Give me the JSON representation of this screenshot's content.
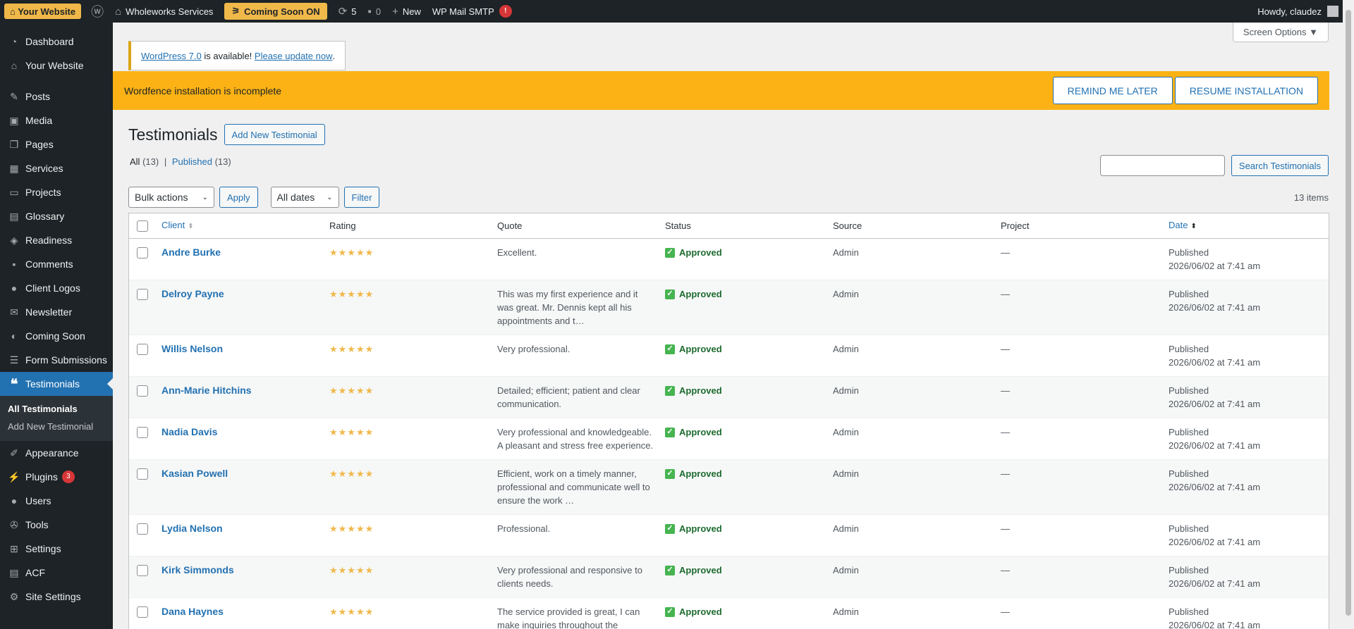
{
  "adminbar": {
    "site_label": "⌂ Your Website",
    "site_name": "Wholeworks Services",
    "coming_soon": "Coming Soon ON",
    "updates_count": "5",
    "comments_count": "0",
    "new_label": "New",
    "smtp_label": "WP Mail SMTP",
    "smtp_badge": "!",
    "howdy": "Howdy, claudez"
  },
  "sidebar": {
    "items": [
      {
        "label": "Dashboard",
        "icon": "dashboard-icon"
      },
      {
        "label": "Your Website",
        "icon": "home-icon"
      },
      {
        "label": "Posts",
        "icon": "pin-icon"
      },
      {
        "label": "Media",
        "icon": "media-icon"
      },
      {
        "label": "Pages",
        "icon": "pages-icon"
      },
      {
        "label": "Services",
        "icon": "grid-icon"
      },
      {
        "label": "Projects",
        "icon": "folder-icon"
      },
      {
        "label": "Glossary",
        "icon": "book-icon"
      },
      {
        "label": "Readiness",
        "icon": "tag-icon"
      },
      {
        "label": "Comments",
        "icon": "comment-icon"
      },
      {
        "label": "Client Logos",
        "icon": "person-icon"
      },
      {
        "label": "Newsletter",
        "icon": "mail-icon"
      },
      {
        "label": "Coming Soon",
        "icon": "megaphone-icon"
      },
      {
        "label": "Form Submissions",
        "icon": "form-icon"
      },
      {
        "label": "Testimonials",
        "icon": "quote-icon"
      },
      {
        "label": "Appearance",
        "icon": "brush-icon"
      },
      {
        "label": "Plugins",
        "icon": "plugin-icon",
        "badge": "3"
      },
      {
        "label": "Users",
        "icon": "users-icon"
      },
      {
        "label": "Tools",
        "icon": "wrench-icon"
      },
      {
        "label": "Settings",
        "icon": "settings-icon"
      },
      {
        "label": "ACF",
        "icon": "acf-icon"
      },
      {
        "label": "Site Settings",
        "icon": "gear-icon"
      }
    ],
    "submenu": {
      "all": "All Testimonials",
      "add_new": "Add New Testimonial"
    }
  },
  "screen_options": "Screen Options ▼",
  "update_nag": {
    "link": "WordPress 7.0",
    "middle": " is available! ",
    "update_link": "Please update now",
    "end": "."
  },
  "wordfence": {
    "message": "Wordfence installation is incomplete",
    "remind": "REMIND ME LATER",
    "resume": "RESUME INSTALLATION"
  },
  "page": {
    "title": "Testimonials",
    "add_new": "Add New Testimonial"
  },
  "views": {
    "all": "All",
    "all_count": "(13)",
    "sep": "|",
    "published": "Published",
    "published_count": "(13)"
  },
  "search": {
    "button": "Search Testimonials"
  },
  "tablenav": {
    "bulk": "Bulk actions",
    "apply": "Apply",
    "dates": "All dates",
    "filter": "Filter",
    "items": "13 items"
  },
  "table": {
    "headers": {
      "client": "Client",
      "rating": "Rating",
      "quote": "Quote",
      "status": "Status",
      "source": "Source",
      "project": "Project",
      "date": "Date"
    },
    "rows": [
      {
        "client": "Andre Burke",
        "rating": "★★★★★",
        "quote": "Excellent.",
        "status": "Approved",
        "source": "Admin",
        "project": "—",
        "date1": "Published",
        "date2": "2026/06/02 at 7:41 am"
      },
      {
        "client": "Delroy Payne",
        "rating": "★★★★★",
        "quote": "This was my first experience and it was great. Mr. Dennis kept all his appointments and t…",
        "status": "Approved",
        "source": "Admin",
        "project": "—",
        "date1": "Published",
        "date2": "2026/06/02 at 7:41 am"
      },
      {
        "client": "Willis Nelson",
        "rating": "★★★★★",
        "quote": "Very professional.",
        "status": "Approved",
        "source": "Admin",
        "project": "—",
        "date1": "Published",
        "date2": "2026/06/02 at 7:41 am"
      },
      {
        "client": "Ann-Marie Hitchins",
        "rating": "★★★★★",
        "quote": "Detailed; efficient; patient and clear communication.",
        "status": "Approved",
        "source": "Admin",
        "project": "—",
        "date1": "Published",
        "date2": "2026/06/02 at 7:41 am"
      },
      {
        "client": "Nadia Davis",
        "rating": "★★★★★",
        "quote": "Very professional and knowledgeable. A pleasant and stress free experience.",
        "status": "Approved",
        "source": "Admin",
        "project": "—",
        "date1": "Published",
        "date2": "2026/06/02 at 7:41 am"
      },
      {
        "client": "Kasian Powell",
        "rating": "★★★★★",
        "quote": "Efficient, work on a timely manner, professional and communicate well to ensure the work …",
        "status": "Approved",
        "source": "Admin",
        "project": "—",
        "date1": "Published",
        "date2": "2026/06/02 at 7:41 am"
      },
      {
        "client": "Lydia Nelson",
        "rating": "★★★★★",
        "quote": "Professional.",
        "status": "Approved",
        "source": "Admin",
        "project": "—",
        "date1": "Published",
        "date2": "2026/06/02 at 7:41 am"
      },
      {
        "client": "Kirk Simmonds",
        "rating": "★★★★★",
        "quote": "Very professional and responsive to clients needs.",
        "status": "Approved",
        "source": "Admin",
        "project": "—",
        "date1": "Published",
        "date2": "2026/06/02 at 7:41 am"
      },
      {
        "client": "Dana Haynes",
        "rating": "★★★★★",
        "quote": "The service provided is great, I can make inquiries throughout the",
        "status": "Approved",
        "source": "Admin",
        "project": "—",
        "date1": "Published",
        "date2": "2026/06/02 at 7:41 am"
      }
    ]
  },
  "colors": {
    "accent": "#2271b1",
    "adminbar": "#1d2327",
    "warning": "#fcb214",
    "approved": "#46b450",
    "star": "#f0b849"
  }
}
